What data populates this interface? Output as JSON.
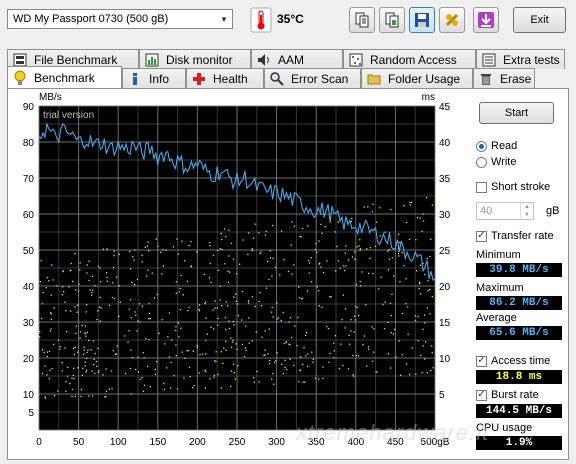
{
  "toolbar": {
    "drive": "WD     My Passport 0730 (500 gB)",
    "temperature": "35°C",
    "icons": [
      "copy-text-icon",
      "copy-image-icon",
      "save-icon",
      "options-icon",
      "download-icon"
    ],
    "exit_label": "Exit"
  },
  "tabs_top": [
    {
      "label": "File Benchmark",
      "icon": "file-benchmark-icon"
    },
    {
      "label": "Disk monitor",
      "icon": "disk-monitor-icon"
    },
    {
      "label": "AAM",
      "icon": "speaker-icon"
    },
    {
      "label": "Random Access",
      "icon": "random-access-icon"
    },
    {
      "label": "Extra tests",
      "icon": "extra-tests-icon"
    }
  ],
  "tabs_bottom": [
    {
      "label": "Benchmark",
      "icon": "lightbulb-icon",
      "active": true
    },
    {
      "label": "Info",
      "icon": "info-icon"
    },
    {
      "label": "Health",
      "icon": "health-cross-icon"
    },
    {
      "label": "Error Scan",
      "icon": "magnifier-icon"
    },
    {
      "label": "Folder Usage",
      "icon": "folder-icon"
    },
    {
      "label": "Erase",
      "icon": "trash-icon"
    }
  ],
  "chart_data": {
    "type": "line",
    "watermark": "trial version",
    "left_axis_label": "MB/s",
    "right_axis_label": "ms",
    "x_unit": "gB",
    "x_ticks": [
      0,
      50,
      100,
      150,
      200,
      250,
      300,
      350,
      400,
      450,
      500
    ],
    "y_ticks_left": [
      5,
      10,
      20,
      30,
      40,
      50,
      60,
      70,
      80,
      90
    ],
    "y_ticks_right": [
      5,
      10,
      15,
      20,
      25,
      30,
      35,
      40,
      45
    ],
    "ylim_left": [
      0,
      90
    ],
    "ylim_right": [
      0,
      45
    ],
    "xlim": [
      0,
      500
    ],
    "grid": true,
    "colors": {
      "background": "#000000",
      "grid": "#7a7a7a",
      "transfer": "#4aa8e8",
      "access": "#e8e840",
      "axis_text": "#000000"
    },
    "series": [
      {
        "name": "Transfer rate",
        "axis": "left",
        "x": [
          0,
          10,
          20,
          30,
          40,
          50,
          60,
          70,
          80,
          90,
          100,
          110,
          120,
          130,
          140,
          150,
          160,
          170,
          180,
          190,
          200,
          210,
          220,
          230,
          240,
          250,
          260,
          270,
          280,
          290,
          300,
          310,
          320,
          330,
          340,
          350,
          360,
          370,
          380,
          390,
          400,
          410,
          420,
          430,
          440,
          450,
          460,
          470,
          480,
          490,
          500
        ],
        "y": [
          82,
          84,
          81,
          83,
          82,
          80,
          81,
          79,
          80,
          78,
          79,
          78,
          79,
          77,
          78,
          76,
          77,
          75,
          74,
          73,
          74,
          72,
          71,
          72,
          70,
          69,
          70,
          68,
          67,
          66,
          66,
          65,
          64,
          63,
          62,
          61,
          61,
          60,
          58,
          57,
          57,
          56,
          55,
          54,
          53,
          52,
          50,
          49,
          47,
          45,
          42
        ]
      },
      {
        "name": "Access time",
        "axis": "right",
        "type": "scatter",
        "x_range": [
          0,
          500
        ],
        "y_min_start": 4,
        "y_max_start": 24,
        "y_min_end": 8,
        "y_max_end": 33
      }
    ]
  },
  "sidebar": {
    "start_label": "Start",
    "read_label": "Read",
    "write_label": "Write",
    "read_selected": true,
    "short_stroke_label": "Short stroke",
    "short_stroke_checked": false,
    "short_stroke_value": "40",
    "short_stroke_unit": "gB",
    "transfer_rate_label": "Transfer rate",
    "transfer_rate_checked": true,
    "minimum_label": "Minimum",
    "minimum_value": "39.8 MB/s",
    "maximum_label": "Maximum",
    "maximum_value": "86.2 MB/s",
    "average_label": "Average",
    "average_value": "65.6 MB/s",
    "access_time_label": "Access time",
    "access_time_checked": true,
    "access_time_value": "18.8 ms",
    "burst_rate_label": "Burst rate",
    "burst_rate_checked": true,
    "burst_rate_value": "144.5 MB/s",
    "cpu_usage_label": "CPU usage",
    "cpu_usage_value": "1.9%"
  },
  "site_watermark": "xtremehardware.it"
}
